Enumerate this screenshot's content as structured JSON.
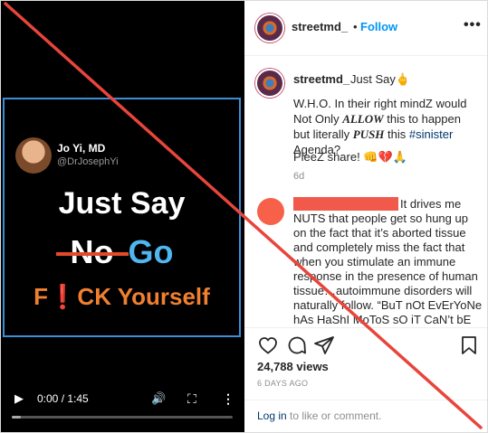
{
  "video": {
    "author_name": "Jo Yi, MD",
    "author_handle": "@DrJosephYi",
    "line1": "Just Say",
    "line2_struck": "No",
    "line2_new": "Go",
    "line3": "F❗CK Yourself",
    "time": "0:00 / 1:45",
    "progress": 0.04,
    "play_icon": "▶",
    "volume_icon": "🔊",
    "fullscreen_icon": "⛶",
    "more_icon": "⋮"
  },
  "header": {
    "username": "streetmd_",
    "dot": "•",
    "follow": "Follow",
    "more": "•••"
  },
  "caption": {
    "username": "streetmd_",
    "title": "Just Say🖕",
    "part1": "W.H.O. In their right mindZ would Not Only ",
    "allow": "ALLOW",
    "part2": " this to happen but literally ",
    "push": "PUSH",
    "part3": " this ",
    "hashtag": "#sinister",
    "part4": " Agenda?",
    "share": "PleeZ share! 👊💔🙏",
    "time": "6d"
  },
  "comment2": {
    "text": "It drives me NUTS that people get so hung up on the fact that it’s aborted tissue and completely miss the fact that when you stimulate an immune response in the presence of human tissue…autoimmune disorders will naturally follow. “BuT nOt EvErYoNe hAs HaShI MoToS sO iT CaN’t bE tHaT!”"
  },
  "actions": {
    "views": "24,788 views",
    "ago": "6 DAYS AGO"
  },
  "login": {
    "link": "Log in",
    "rest": " to like or comment."
  },
  "colors": {
    "accent_blue": "#0095f6",
    "cross_red": "#e8453c",
    "clip_border": "#3a8fd6"
  }
}
